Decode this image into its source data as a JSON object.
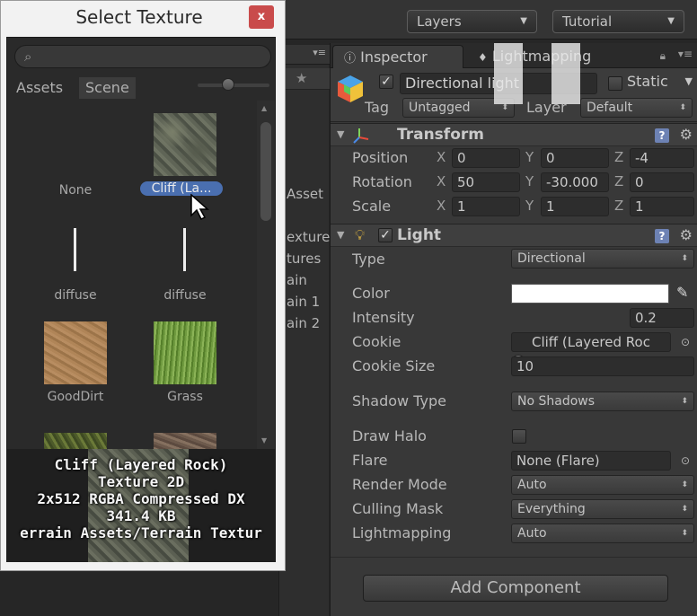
{
  "toolbar": {
    "layers_label": "Layers",
    "layout_label": "Tutorial"
  },
  "project_panel": {
    "rows": [
      "Asset",
      "exture",
      "tures",
      "ain",
      "ain 1",
      "ain 2"
    ]
  },
  "inspector": {
    "tabs": [
      {
        "label": "Inspector",
        "active": true
      },
      {
        "label": "Lightmapping",
        "active": false
      }
    ],
    "object": {
      "enabled": true,
      "name": "Directional light",
      "static_label": "Static",
      "static_checked": false,
      "tag_label": "Tag",
      "tag_value": "Untagged",
      "layer_label": "Layer",
      "layer_value": "Default"
    },
    "transform": {
      "title": "Transform",
      "position_label": "Position",
      "rotation_label": "Rotation",
      "scale_label": "Scale",
      "position": {
        "x": "0",
        "y": "0",
        "z": "-4"
      },
      "rotation": {
        "x": "50",
        "y": "-30.000",
        "z": "0"
      },
      "scale": {
        "x": "1",
        "y": "1",
        "z": "1"
      }
    },
    "light": {
      "title": "Light",
      "enabled": true,
      "type_label": "Type",
      "type_value": "Directional",
      "color_label": "Color",
      "color_value": "#ffffff",
      "intensity_label": "Intensity",
      "intensity_value": "0.2",
      "cookie_label": "Cookie",
      "cookie_value": "Cliff (Layered Roc",
      "cookie_size_label": "Cookie Size",
      "cookie_size_value": "10",
      "shadow_type_label": "Shadow Type",
      "shadow_type_value": "No Shadows",
      "draw_halo_label": "Draw Halo",
      "draw_halo_checked": false,
      "flare_label": "Flare",
      "flare_value": "None (Flare)",
      "render_mode_label": "Render Mode",
      "render_mode_value": "Auto",
      "culling_mask_label": "Culling Mask",
      "culling_mask_value": "Everything",
      "lightmapping_label": "Lightmapping",
      "lightmapping_value": "Auto"
    },
    "add_component_label": "Add Component"
  },
  "select_texture": {
    "title": "Select Texture",
    "close_label": "x",
    "search_value": "",
    "tabs": [
      {
        "label": "Assets",
        "active": false
      },
      {
        "label": "Scene",
        "active": true
      }
    ],
    "items": [
      {
        "label": "None",
        "texture": "none"
      },
      {
        "label": "Cliff (La...",
        "texture": "cliff",
        "selected": true
      },
      {
        "label": "diffuse",
        "texture": "diffuse"
      },
      {
        "label": "diffuse",
        "texture": "diffuse"
      },
      {
        "label": "GoodDirt",
        "texture": "dirt"
      },
      {
        "label": "Grass",
        "texture": "grass"
      }
    ],
    "preview": {
      "line1": "Cliff (Layered Rock)",
      "line2": "Texture 2D",
      "line3": "2x512  RGBA Compressed DX",
      "line4": "341.4 KB",
      "line5": "errain Assets/Terrain Textur"
    }
  },
  "colors": {
    "accent_selection": "#4a6fb0",
    "close_button": "#c94b4b",
    "help_icon": "#6d82b4"
  }
}
